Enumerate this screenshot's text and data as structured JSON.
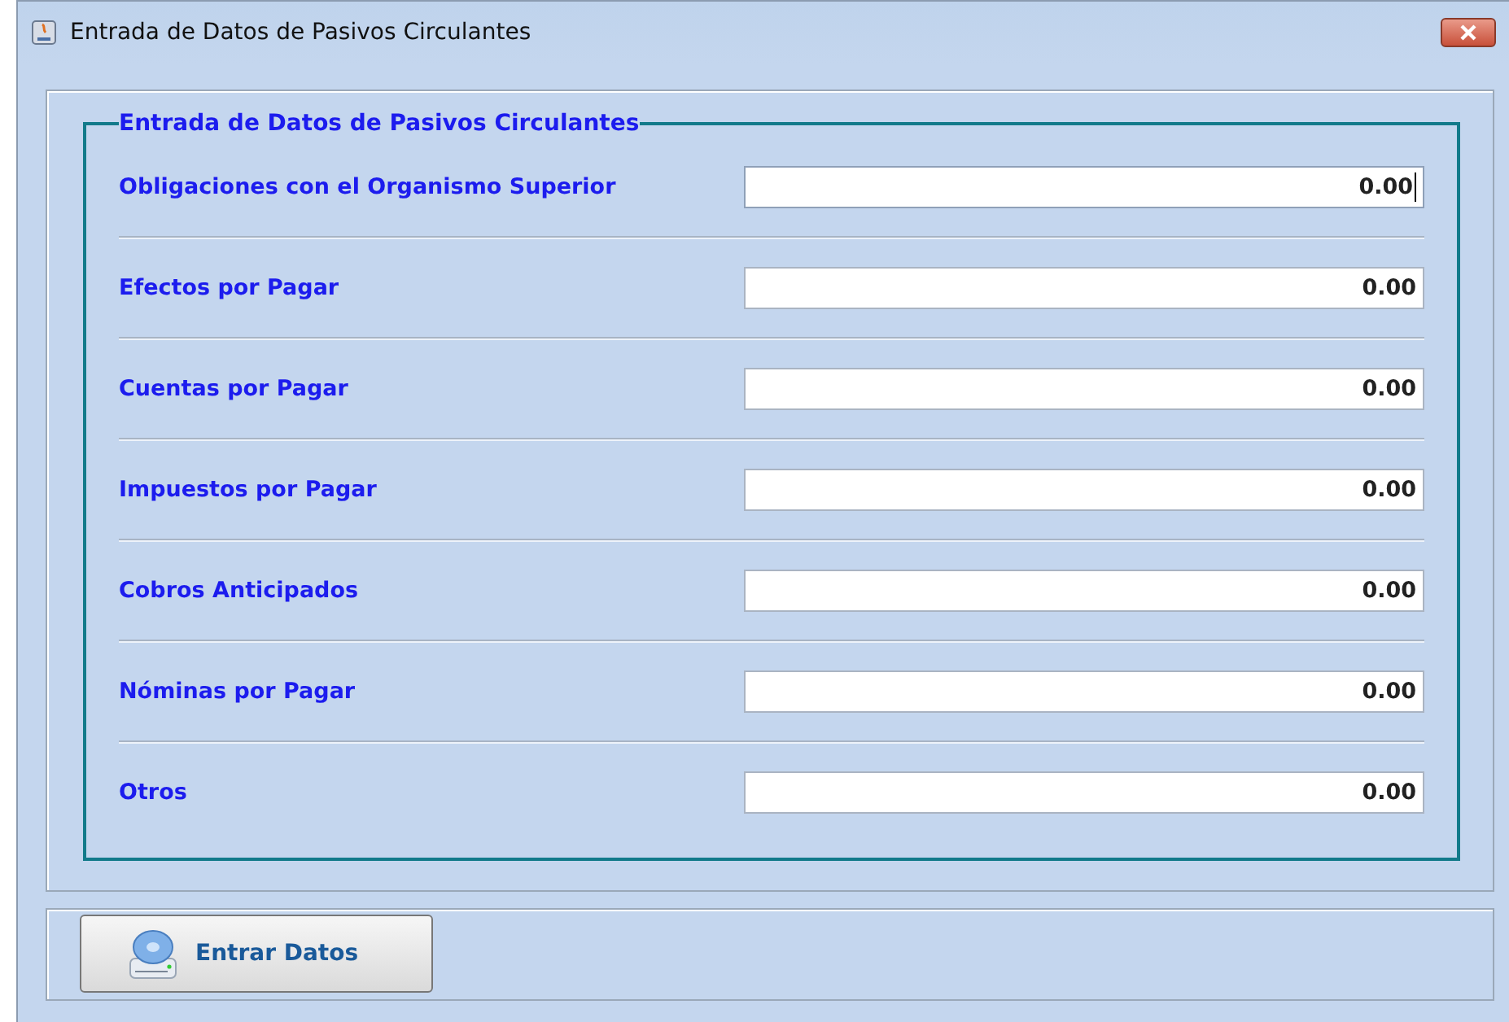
{
  "window": {
    "title": "Entrada de Datos de Pasivos Circulantes"
  },
  "group": {
    "title": "Entrada de Datos de Pasivos Circulantes"
  },
  "fields": [
    {
      "label": "Obligaciones con el Organismo Superior",
      "value": "0.00",
      "focused": true
    },
    {
      "label": "Efectos por Pagar",
      "value": "0.00",
      "focused": false
    },
    {
      "label": "Cuentas por Pagar",
      "value": "0.00",
      "focused": false
    },
    {
      "label": "Impuestos por Pagar",
      "value": "0.00",
      "focused": false
    },
    {
      "label": "Cobros Anticipados",
      "value": "0.00",
      "focused": false
    },
    {
      "label": "Nóminas por Pagar",
      "value": "0.00",
      "focused": false
    },
    {
      "label": "Otros",
      "value": "0.00",
      "focused": false
    }
  ],
  "buttons": [
    {
      "label": "Entrar Datos"
    }
  ]
}
